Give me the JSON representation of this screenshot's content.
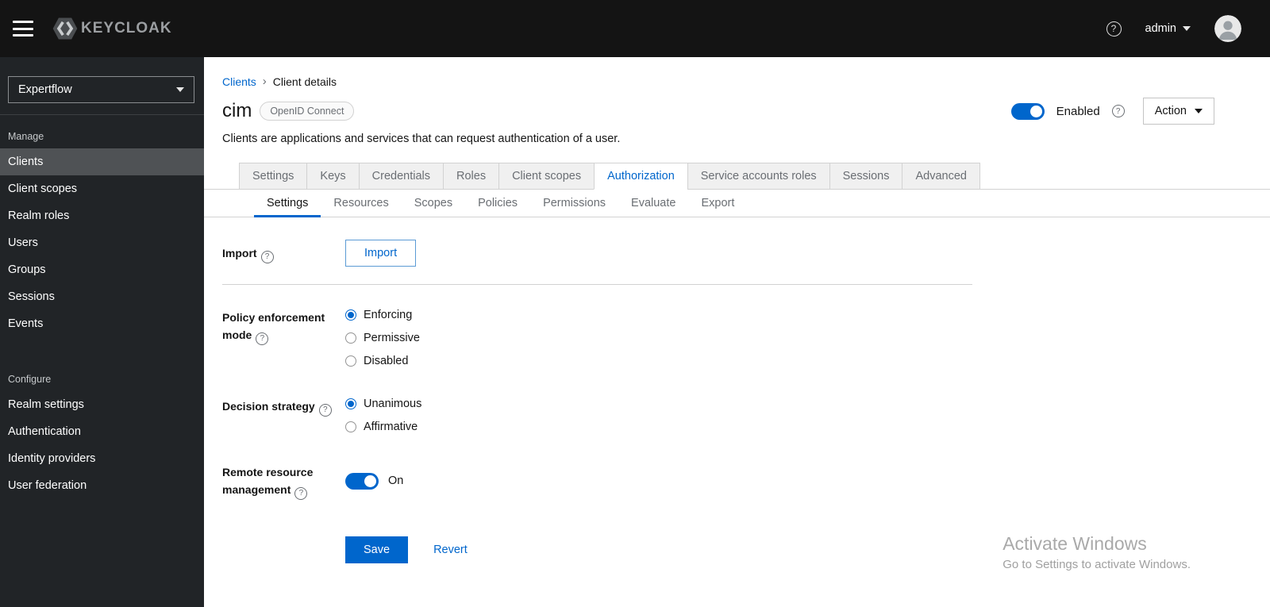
{
  "colors": {
    "primary": "#0066cc",
    "header_bg": "#141414",
    "sidebar_bg": "#212427",
    "sidebar_active_bg": "#4f5255",
    "tab_inactive_bg": "#f0f0f0"
  },
  "icons": {
    "help_glyph": "?",
    "breadcrumb_separator": "›"
  },
  "header": {
    "brand": "KEYCLOAK",
    "username": "admin"
  },
  "sidebar": {
    "realm": "Expertflow",
    "sections": [
      {
        "label": "Manage",
        "items": [
          "Clients",
          "Client scopes",
          "Realm roles",
          "Users",
          "Groups",
          "Sessions",
          "Events"
        ],
        "active_item": "Clients"
      },
      {
        "label": "Configure",
        "items": [
          "Realm settings",
          "Authentication",
          "Identity providers",
          "User federation"
        ]
      }
    ]
  },
  "breadcrumb": {
    "parent": "Clients",
    "current": "Client details"
  },
  "page": {
    "title": "cim",
    "protocol_badge": "OpenID Connect",
    "description": "Clients are applications and services that can request authentication of a user.",
    "enabled_label": "Enabled",
    "action_button": "Action"
  },
  "tabs": {
    "main": [
      "Settings",
      "Keys",
      "Credentials",
      "Roles",
      "Client scopes",
      "Authorization",
      "Service accounts roles",
      "Sessions",
      "Advanced"
    ],
    "active_main": "Authorization",
    "sub": [
      "Settings",
      "Resources",
      "Scopes",
      "Policies",
      "Permissions",
      "Evaluate",
      "Export"
    ],
    "active_sub": "Settings"
  },
  "form": {
    "import": {
      "label": "Import",
      "button": "Import"
    },
    "policy_enforcement_mode": {
      "label": "Policy enforcement mode",
      "options": [
        "Enforcing",
        "Permissive",
        "Disabled"
      ],
      "selected": "Enforcing"
    },
    "decision_strategy": {
      "label": "Decision strategy",
      "options": [
        "Unanimous",
        "Affirmative"
      ],
      "selected": "Unanimous"
    },
    "remote_resource_management": {
      "label": "Remote resource management",
      "state_label": "On"
    },
    "save_button": "Save",
    "revert_link": "Revert"
  },
  "watermark": {
    "title": "Activate Windows",
    "subtitle": "Go to Settings to activate Windows."
  }
}
